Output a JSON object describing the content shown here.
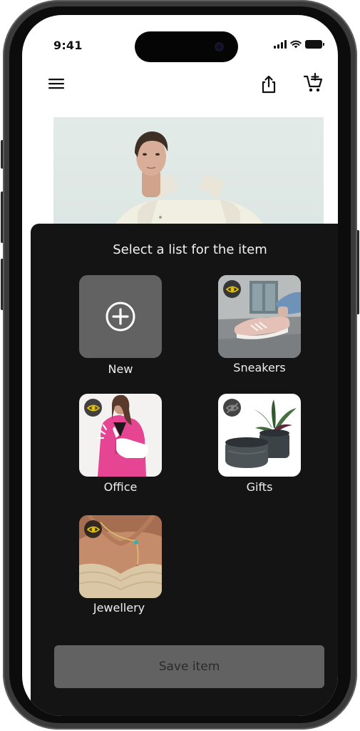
{
  "status_bar": {
    "time": "9:41"
  },
  "header": {
    "menu_icon": "hamburger-menu-icon",
    "share_icon": "share-icon",
    "cart_icon": "add-to-cart-icon"
  },
  "sheet": {
    "title": "Select a list for the item",
    "lists": [
      {
        "label": "New",
        "icon": "plus-circle-icon"
      },
      {
        "label": "Sneakers",
        "visibility": "visible",
        "icon": "eye-icon"
      },
      {
        "label": "Office",
        "visibility": "visible",
        "icon": "eye-icon"
      },
      {
        "label": "Gifts",
        "visibility": "hidden",
        "icon": "eye-off-icon"
      },
      {
        "label": "Jewellery",
        "visibility": "visible",
        "icon": "eye-icon"
      }
    ],
    "save_label": "Save item"
  },
  "colors": {
    "sheet_bg": "#141414",
    "tile_placeholder": "#626262",
    "eye_accent": "#e8c400"
  }
}
